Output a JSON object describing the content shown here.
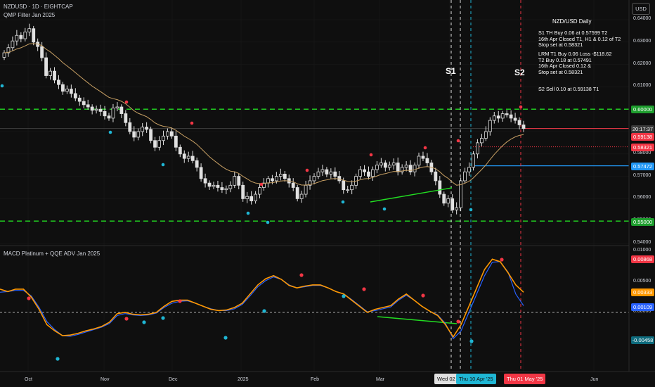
{
  "header": {
    "symbol_line": "NZDUSD · 1D · EIGHTCAP",
    "indicator_line": "QMP Filter Jan 2025",
    "sub_indicator": "MACD Platinum + QQE ADV Jan 2025",
    "currency_button": "USD"
  },
  "annotation": {
    "title": "NZD/USD Daily",
    "s1": "S1 TH Buy 0.06 at 0.57599 T2\n16th Apr Closed T1, H1 & 0.12 of T2\nStop set at 0.58321",
    "lrm": "LRM T1 Buy 0.06 Loss -$118.62\nT2 Buy 0.18 at 0.57491\n16th Apr Closed 0.12 &\nStop set at 0.58321",
    "s2": "S2 Sell 0.10 at 0.59138 T1",
    "marker_s1": "S1",
    "marker_s2": "S2"
  },
  "colors": {
    "background": "#0f0f0f",
    "up_candle": "#e0e0e0",
    "down_candle": "#e0e0e0",
    "ma_line": "#c8a064",
    "green_level": "#22dd22",
    "red_level": "#f23645",
    "blue_level": "#2196f3",
    "macd_fast": "#ff9800",
    "macd_slow": "#2962ff",
    "dot_red": "#f23645",
    "dot_cyan": "#1fb6d4"
  },
  "price_axis": {
    "ticks": [
      "0.64000",
      "0.63000",
      "0.62000",
      "0.61000",
      "0.60000",
      "0.59000",
      "0.58000",
      "0.57000",
      "0.56000",
      "0.55000",
      "0.54000"
    ],
    "badges": [
      {
        "label": "0.60000",
        "color": "#1e9e2e"
      },
      {
        "label": "20:17:37",
        "color": "#3a3a3a"
      },
      {
        "label": "0.59138",
        "color": "#f23645"
      },
      {
        "label": "0.58321",
        "color": "#f23645"
      },
      {
        "label": "0.57472",
        "color": "#2196f3"
      },
      {
        "label": "0.55000",
        "color": "#1e9e2e"
      }
    ]
  },
  "macd_axis": {
    "ticks": [
      "0.01000",
      "0.00500",
      "0.00000"
    ],
    "badges": [
      {
        "label": "0.00868",
        "color": "#f23645"
      },
      {
        "label": "0.00333",
        "color": "#ff9800"
      },
      {
        "label": "0.00109",
        "color": "#2962ff"
      },
      {
        "label": "-0.00458",
        "color": "#0e6b7d"
      }
    ]
  },
  "time_axis": {
    "labels": [
      "Oct",
      "Nov",
      "Dec",
      "2025",
      "Feb",
      "Mar",
      "Apr",
      "May",
      "Jun"
    ],
    "date_badges": [
      {
        "label": "Wed 02 A",
        "color": "#e0e0e0",
        "text": "#111"
      },
      {
        "label": "Thu 10 Apr '25",
        "color": "#1fb6d4",
        "text": "#111"
      },
      {
        "label": "Thu 01 May '25",
        "color": "#f23645",
        "text": "#fff"
      }
    ]
  },
  "chart_data": {
    "type": "candlestick",
    "price_levels": {
      "green_upper": 0.6,
      "green_lower": 0.55,
      "red_sell": 0.59138,
      "red_stop": 0.58321,
      "blue_entry": 0.57472
    },
    "close_series": [
      0.6252,
      0.6275,
      0.6305,
      0.633,
      0.6315,
      0.6345,
      0.636,
      0.63,
      0.628,
      0.623,
      0.615,
      0.617,
      0.613,
      0.611,
      0.608,
      0.609,
      0.607,
      0.605,
      0.6035,
      0.602,
      0.601,
      0.5995,
      0.6,
      0.599,
      0.597,
      0.596,
      0.6005,
      0.601,
      0.598,
      0.594,
      0.59,
      0.5875,
      0.59,
      0.592,
      0.591,
      0.586,
      0.583,
      0.586,
      0.588,
      0.59,
      0.588,
      0.583,
      0.58,
      0.578,
      0.579,
      0.577,
      0.574,
      0.569,
      0.567,
      0.5655,
      0.566,
      0.565,
      0.564,
      0.5645,
      0.566,
      0.57,
      0.566,
      0.56,
      0.561,
      0.559,
      0.562,
      0.565,
      0.567,
      0.569,
      0.568,
      0.57,
      0.571,
      0.569,
      0.567,
      0.565,
      0.56,
      0.562,
      0.566,
      0.568,
      0.57,
      0.572,
      0.573,
      0.571,
      0.572,
      0.57,
      0.568,
      0.564,
      0.564,
      0.566,
      0.57,
      0.573,
      0.572,
      0.57,
      0.573,
      0.575,
      0.576,
      0.574,
      0.575,
      0.576,
      0.572,
      0.574,
      0.575,
      0.572,
      0.575,
      0.579,
      0.578,
      0.576,
      0.572,
      0.568,
      0.562,
      0.558,
      0.56,
      0.555,
      0.556,
      0.568,
      0.572,
      0.574,
      0.58,
      0.585,
      0.587,
      0.59,
      0.595,
      0.597,
      0.596,
      0.598,
      0.5975,
      0.596,
      0.595,
      0.593,
      0.5914
    ],
    "macd_fast": [
      0.0038,
      0.0034,
      0.0038,
      0.0038,
      0.0025,
      0.0005,
      -0.002,
      -0.003,
      -0.0038,
      -0.0037,
      -0.0034,
      -0.003,
      -0.0027,
      -0.0023,
      -0.0016,
      -0.0002,
      0.0,
      -0.0003,
      -0.0004,
      -0.0003,
      0.0,
      0.001,
      0.0018,
      0.002,
      0.002,
      0.0015,
      0.001,
      0.0005,
      0.0003,
      0.0004,
      0.0008,
      0.0015,
      0.003,
      0.0045,
      0.0055,
      0.006,
      0.0054,
      0.0044,
      0.004,
      0.0043,
      0.0045,
      0.0045,
      0.004,
      0.0034,
      0.003,
      0.002,
      0.001,
      0.0,
      0.0005,
      0.0008,
      0.0011,
      0.0022,
      0.003,
      0.002,
      0.001,
      0.0002,
      -0.0005,
      -0.002,
      -0.004,
      -0.002,
      0.001,
      0.004,
      0.007,
      0.0087,
      0.0083,
      0.0065,
      0.0045,
      0.0033
    ],
    "macd_slow": [
      0.0033,
      0.0034,
      0.0036,
      0.0036,
      0.0027,
      0.0008,
      -0.0015,
      -0.0028,
      -0.0038,
      -0.0039,
      -0.0036,
      -0.0032,
      -0.0028,
      -0.0024,
      -0.0018,
      -0.0005,
      -0.0002,
      -0.0004,
      -0.0005,
      -0.0004,
      -0.0001,
      0.0008,
      0.0015,
      0.0018,
      0.0019,
      0.0015,
      0.001,
      0.0006,
      0.0003,
      0.0003,
      0.0006,
      0.0013,
      0.0027,
      0.0042,
      0.0052,
      0.0058,
      0.0054,
      0.0045,
      0.004,
      0.0042,
      0.0044,
      0.0044,
      0.004,
      0.0034,
      0.003,
      0.0021,
      0.0011,
      0.0001,
      0.0003,
      0.0006,
      0.0009,
      0.002,
      0.0028,
      0.002,
      0.001,
      0.0002,
      -0.0004,
      -0.0018,
      -0.0043,
      -0.003,
      0.0,
      0.003,
      0.006,
      0.0082,
      0.0083,
      0.0066,
      0.003,
      0.0011
    ]
  }
}
